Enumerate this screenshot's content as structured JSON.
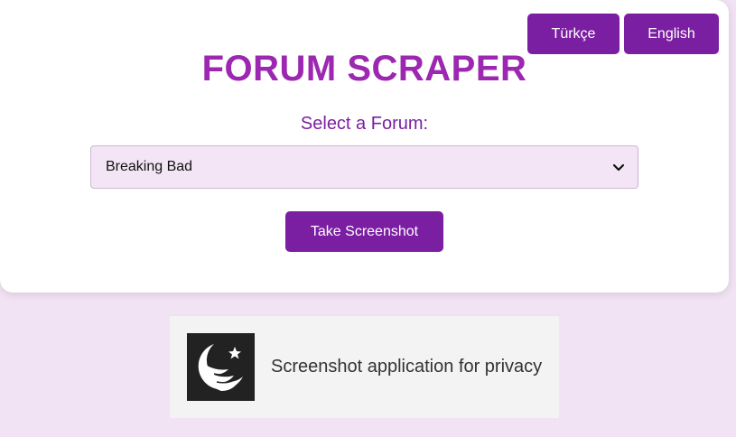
{
  "languages": {
    "turkish_label": "Türkçe",
    "english_label": "English"
  },
  "header": {
    "title": "FORUM SCRAPER"
  },
  "form": {
    "select_label": "Select a Forum:",
    "selected_forum": "Breaking Bad",
    "screenshot_button": "Take Screenshot"
  },
  "footer": {
    "logo_icon": "moon-star-bird-logo-icon",
    "tagline": "Screenshot application for privacy"
  },
  "colors": {
    "page_background": "#f2e3f4",
    "button_purple": "#7b1fa2",
    "title_purple": "#9c27b0",
    "select_background": "#f3e5f5"
  }
}
